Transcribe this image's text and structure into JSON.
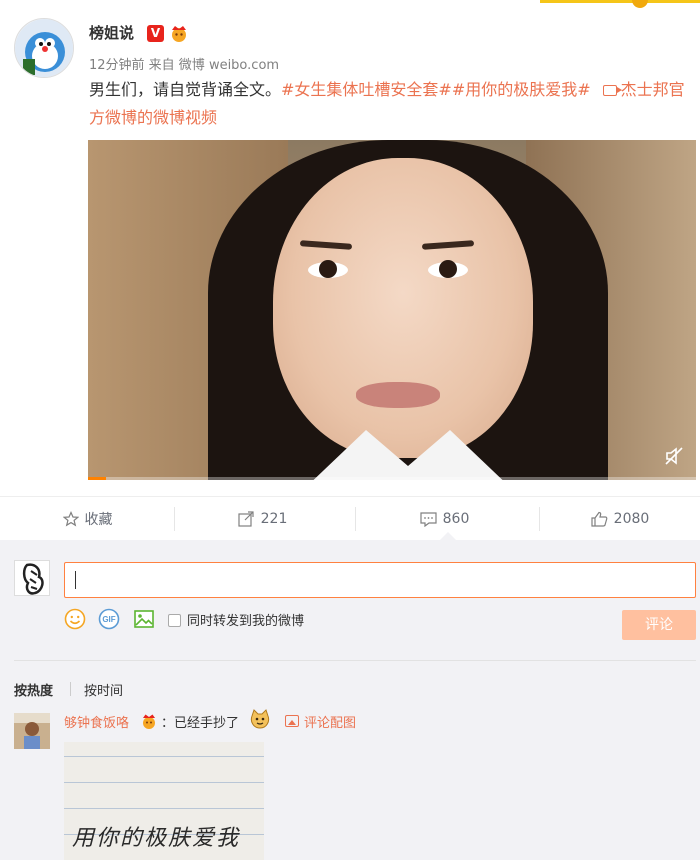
{
  "post": {
    "username": "榜姐说",
    "v_badge": "V",
    "meta": "12分钟前 来自 微博 weibo.com",
    "text_plain": "男生们，请自觉背诵全文。",
    "tag1": "#女生集体吐槽安全套#",
    "tag2": "#用你的极肤爱我#",
    "video_link": "杰士邦官方微博的微博视频"
  },
  "actions": {
    "favorite": "收藏",
    "repost": "221",
    "comment": "860",
    "like": "2080"
  },
  "composer": {
    "input_value": "",
    "also_repost_label": "同时转发到我的微博",
    "submit_label": "评论"
  },
  "sort": {
    "hot": "按热度",
    "time": "按时间"
  },
  "comment": {
    "username": "够钟食饭咯",
    "text": "：已经手抄了",
    "pic_link": "评论配图",
    "image_text": "用你的极肤爱我"
  },
  "icons": {
    "favorite": "star-icon",
    "repost": "share-icon",
    "comment": "comment-icon",
    "like": "thumbs-up-icon",
    "emoji": "smiley-icon",
    "gif": "gif-icon",
    "image": "image-icon"
  },
  "colors": {
    "accent": "#eb7350",
    "input_border": "#ff8140",
    "submit_disabled": "#ffc09f"
  }
}
